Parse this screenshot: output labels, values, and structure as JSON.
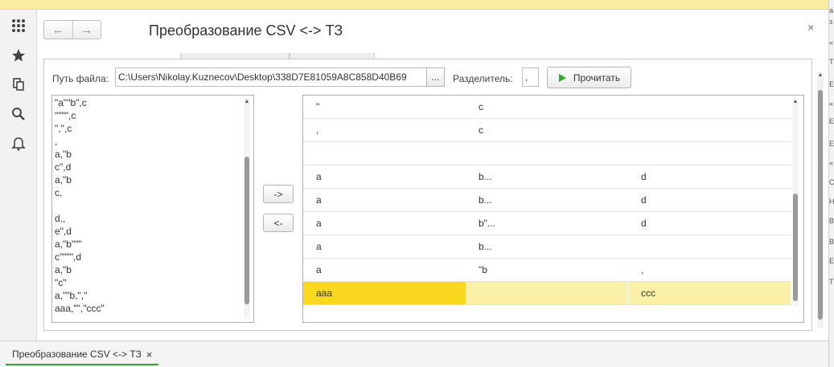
{
  "window": {
    "title": "Преобразование CSV <-> ТЗ",
    "close_glyph": "×",
    "nav": {
      "back_glyph": "←",
      "forward_glyph": "→"
    }
  },
  "sidebar": {
    "icons": [
      "apps-grid-icon",
      "favorites-star-icon",
      "history-icon",
      "search-icon",
      "notifications-bell-icon"
    ]
  },
  "form": {
    "file_label": "Путь файла:",
    "file_value": "C:\\Users\\Nikolay.Kuznecov\\Desktop\\338D7E81059A8C858D40B69",
    "browse_label": "...",
    "separator_label": "Разделитель:",
    "separator_value": ",",
    "read_button_label": "Прочитать",
    "to_table_label": "->",
    "to_text_label": "<-"
  },
  "csv_text_lines": [
    "\"a\"\"b\",c",
    "\"\"\"\",c",
    "\",\",c",
    ",",
    "a,\"b",
    "c\",d",
    "a,\"b",
    "c,",
    "",
    "d,,",
    "e\",d",
    "a,\"b\"\"\"",
    "c\"\"\"\",d",
    "a,\"b",
    "\"c\"",
    "a,\"\"b,\",\"",
    "aaa,\"\",\"ccc\""
  ],
  "table": {
    "rows": [
      [
        "\"",
        "c",
        ""
      ],
      [
        ",",
        "c",
        ""
      ],
      [
        "",
        "",
        ""
      ],
      [
        "a",
        "b...",
        "d"
      ],
      [
        "a",
        "b...",
        "d"
      ],
      [
        "a",
        "b\"...",
        "d"
      ],
      [
        "a",
        "b...",
        ""
      ],
      [
        "a",
        "\"b",
        ","
      ],
      [
        "aaa",
        "",
        "ccc"
      ]
    ],
    "selected_row": 8
  },
  "taskbar": {
    "tab_label": "Преобразование CSV <-> ТЗ",
    "tab_close": "×"
  },
  "right_edge_glyphs": [
    "а",
    "з",
    "«",
    "Т",
    "Е",
    "«",
    "Е",
    "Е",
    "«",
    "С",
    "Н",
    "В",
    "В",
    "Е",
    "Т"
  ],
  "colors": {
    "topbar": "#fbeda0",
    "selected_row": "#fbf0a8",
    "selected_cell": "#f9d81f",
    "play_icon": "#2eaa2e",
    "active_tab_underline": "#3c9a3c"
  }
}
